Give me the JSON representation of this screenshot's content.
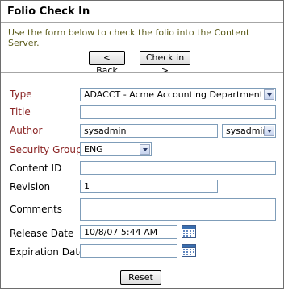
{
  "header": {
    "title": "Folio Check In",
    "instructions": "Use the form below to check the folio into the Content Server."
  },
  "actions": {
    "back_label": "< Back",
    "checkin_label": "Check in >"
  },
  "form": {
    "type": {
      "label": "Type",
      "value": "ADACCT - Acme Accounting Department"
    },
    "title": {
      "label": "Title",
      "value": ""
    },
    "author": {
      "label": "Author",
      "value": "sysadmin",
      "select_value": "sysadmin"
    },
    "security_group": {
      "label": "Security Group",
      "value": "ENG"
    },
    "content_id": {
      "label": "Content ID",
      "value": ""
    },
    "revision": {
      "label": "Revision",
      "value": "1"
    },
    "comments": {
      "label": "Comments",
      "value": ""
    },
    "release_date": {
      "label": "Release Date",
      "value": "10/8/07 5:44 AM"
    },
    "expiration_date": {
      "label": "Expiration Date",
      "value": ""
    }
  },
  "footer": {
    "reset_label": "Reset"
  },
  "icons": {
    "dropdown": "chevron-down-icon",
    "calendar": "calendar-icon"
  },
  "colors": {
    "required_label": "#8b2525",
    "instructions_text": "#5b5b1a",
    "field_border": "#7f9db9"
  }
}
